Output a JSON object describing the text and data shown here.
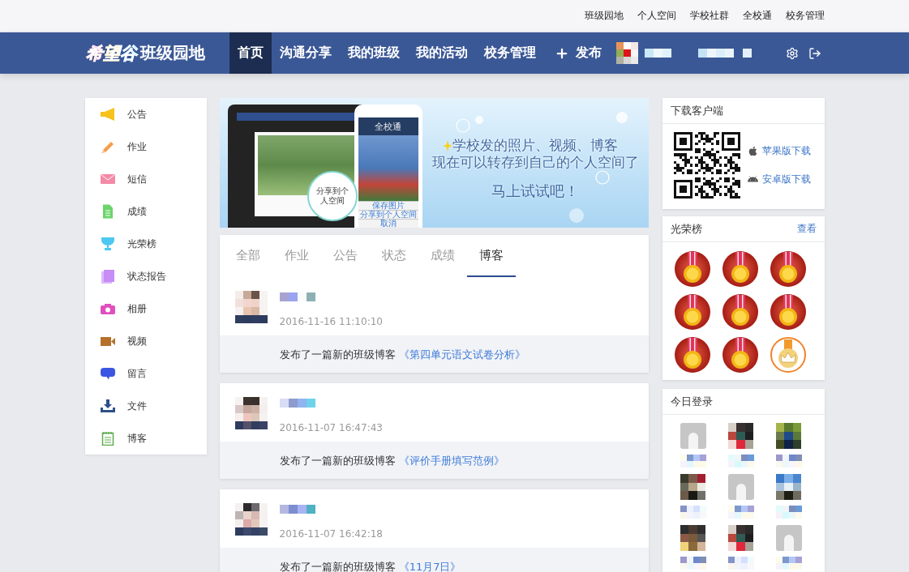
{
  "top_links": [
    "班级园地",
    "个人空间",
    "学校社群",
    "全校通",
    "校务管理"
  ],
  "brand": {
    "logo_text": "希望谷",
    "title": "班级园地"
  },
  "nav": [
    {
      "label": "首页",
      "selected": true
    },
    {
      "label": "沟通分享",
      "selected": false
    },
    {
      "label": "我的班级",
      "selected": false
    },
    {
      "label": "我的活动",
      "selected": false
    },
    {
      "label": "校务管理",
      "selected": false
    }
  ],
  "publish_button": {
    "label": "发布"
  },
  "sidebar": {
    "items": [
      {
        "label": "公告"
      },
      {
        "label": "作业"
      },
      {
        "label": "短信"
      },
      {
        "label": "成绩"
      },
      {
        "label": "光荣榜"
      },
      {
        "label": "状态报告"
      },
      {
        "label": "相册"
      },
      {
        "label": "视频"
      },
      {
        "label": "留言"
      },
      {
        "label": "文件"
      },
      {
        "label": "博客"
      }
    ]
  },
  "banner": {
    "phone_title": "全校通",
    "phone_buttons": [
      "保存图片",
      "分享到个人空间",
      "取消"
    ],
    "share_bubble": "分享到个人空间",
    "headline": [
      "学校发的照片、视频、博客",
      "现在可以转存到自己的个人空间了"
    ],
    "call_to_action": "马上试试吧！"
  },
  "feed": {
    "tabs": [
      {
        "label": "全部",
        "selected": false
      },
      {
        "label": "作业",
        "selected": false
      },
      {
        "label": "公告",
        "selected": false
      },
      {
        "label": "状态",
        "selected": false
      },
      {
        "label": "成绩",
        "selected": false
      },
      {
        "label": "博客",
        "selected": true
      }
    ],
    "posts": [
      {
        "time": "2016-11-16 11:10:10",
        "action": "发布了一篇新的班级博客",
        "link": "《第四单元语文试卷分析》"
      },
      {
        "time": "2016-11-07 16:47:43",
        "action": "发布了一篇新的班级博客",
        "link": "《评价手册填写范例》"
      },
      {
        "time": "2016-11-07 16:42:18",
        "action": "发布了一篇新的班级博客",
        "link": "《11月7日》"
      }
    ]
  },
  "download": {
    "title": "下载客户端",
    "links": [
      {
        "kind": "apple",
        "label": "苹果版下载"
      },
      {
        "kind": "android",
        "label": "安卓版下载"
      }
    ]
  },
  "honor_board": {
    "title": "光荣榜",
    "more": "查看",
    "badges": [
      {
        "kind": "medal"
      },
      {
        "kind": "medal"
      },
      {
        "kind": "medal"
      },
      {
        "kind": "medal"
      },
      {
        "kind": "medal"
      },
      {
        "kind": "medal"
      },
      {
        "kind": "medal"
      },
      {
        "kind": "medal"
      },
      {
        "kind": "crown"
      }
    ]
  },
  "today_logins": {
    "title": "今日登录",
    "users": [
      {
        "kind": "default"
      },
      {
        "kind": "photo"
      },
      {
        "kind": "photo"
      },
      {
        "kind": "photo"
      },
      {
        "kind": "default"
      },
      {
        "kind": "photo"
      },
      {
        "kind": "photo"
      },
      {
        "kind": "photo"
      },
      {
        "kind": "default"
      }
    ]
  }
}
